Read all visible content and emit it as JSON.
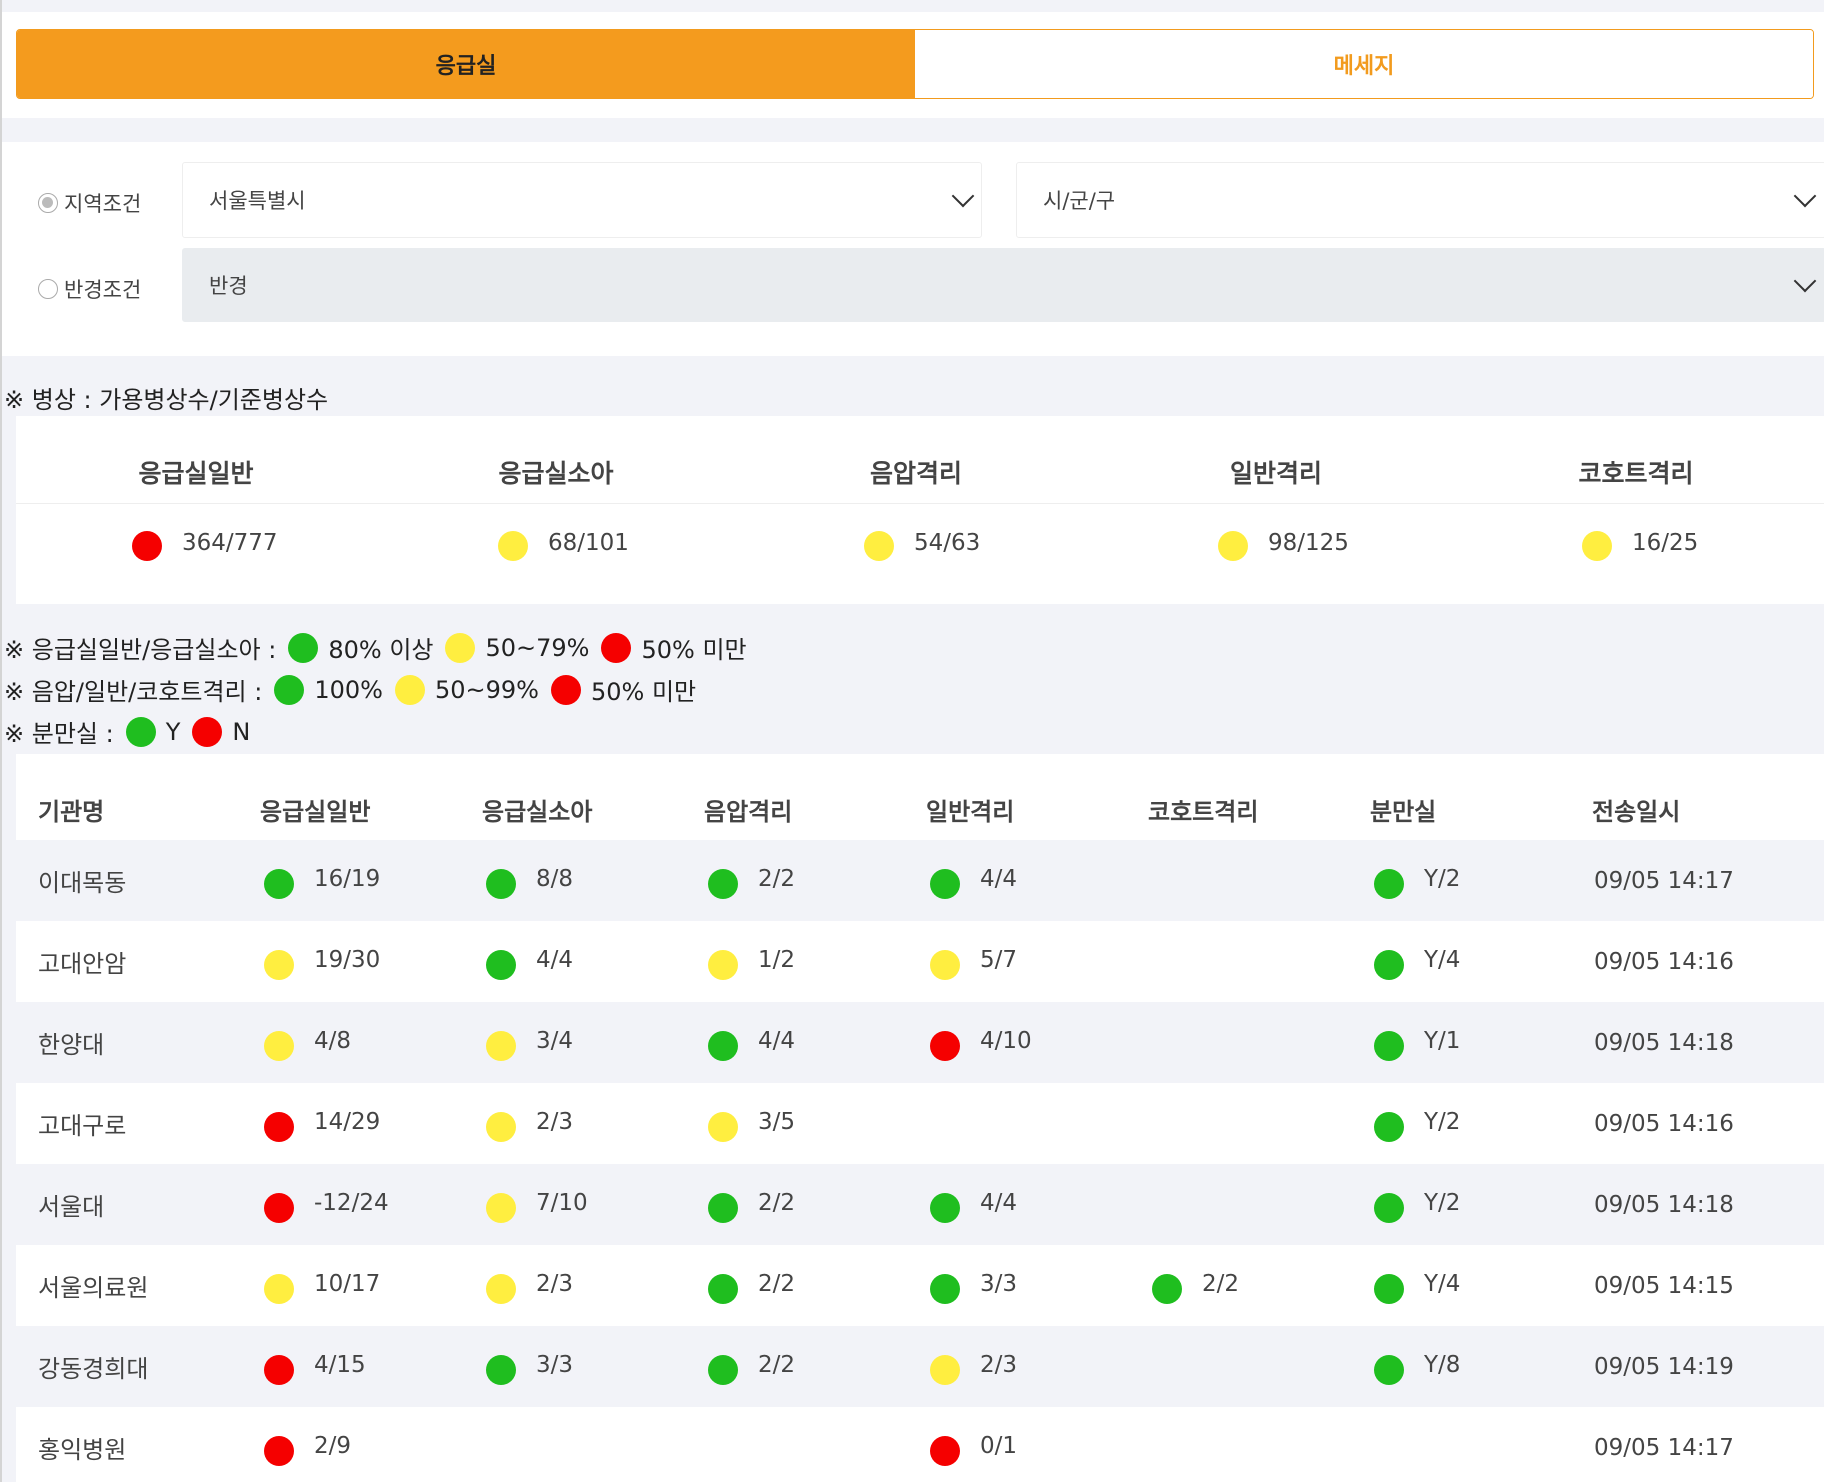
{
  "tabs": [
    {
      "label": "응급실",
      "active": true
    },
    {
      "label": "메세지",
      "active": false
    }
  ],
  "filter": {
    "region_label": "지역조건",
    "radius_label": "반경조건",
    "city_value": "서울특별시",
    "district_value": "시/군/구",
    "radius_value": "반경"
  },
  "bed_note": "※ 병상 : 가용병상수/기준병상수",
  "summary": {
    "headers": [
      "응급실일반",
      "응급실소아",
      "음압격리",
      "일반격리",
      "코호트격리"
    ],
    "cells": [
      {
        "status": "red",
        "value": "364/777"
      },
      {
        "status": "yellow",
        "value": "68/101"
      },
      {
        "status": "yellow",
        "value": "54/63"
      },
      {
        "status": "yellow",
        "value": "98/125"
      },
      {
        "status": "yellow",
        "value": "16/25"
      }
    ]
  },
  "legend": {
    "line1_prefix": "※ 응급실일반/응급실소아 :",
    "line1_items": [
      {
        "color": "green",
        "text": "80% 이상"
      },
      {
        "color": "yellow",
        "text": "50~79%"
      },
      {
        "color": "red",
        "text": "50% 미만"
      }
    ],
    "line2_prefix": "※ 음압/일반/코호트격리 :",
    "line2_items": [
      {
        "color": "green",
        "text": "100%"
      },
      {
        "color": "yellow",
        "text": "50~99%"
      },
      {
        "color": "red",
        "text": "50% 미만"
      }
    ],
    "line3_prefix": "※ 분만실 :",
    "line3_items": [
      {
        "color": "green",
        "text": "Y"
      },
      {
        "color": "red",
        "text": "N"
      }
    ]
  },
  "table": {
    "headers": [
      "기관명",
      "응급실일반",
      "응급실소아",
      "음압격리",
      "일반격리",
      "코호트격리",
      "분만실",
      "전송일시"
    ],
    "rows": [
      {
        "name": "이대목동",
        "cells": [
          [
            "green",
            "16/19"
          ],
          [
            "green",
            "8/8"
          ],
          [
            "green",
            "2/2"
          ],
          [
            "green",
            "4/4"
          ],
          null,
          [
            "green",
            "Y/2"
          ]
        ],
        "time": "09/05 14:17"
      },
      {
        "name": "고대안암",
        "cells": [
          [
            "yellow",
            "19/30"
          ],
          [
            "green",
            "4/4"
          ],
          [
            "yellow",
            "1/2"
          ],
          [
            "yellow",
            "5/7"
          ],
          null,
          [
            "green",
            "Y/4"
          ]
        ],
        "time": "09/05 14:16"
      },
      {
        "name": "한양대",
        "cells": [
          [
            "yellow",
            "4/8"
          ],
          [
            "yellow",
            "3/4"
          ],
          [
            "green",
            "4/4"
          ],
          [
            "red",
            "4/10"
          ],
          null,
          [
            "green",
            "Y/1"
          ]
        ],
        "time": "09/05 14:18"
      },
      {
        "name": "고대구로",
        "cells": [
          [
            "red",
            "14/29"
          ],
          [
            "yellow",
            "2/3"
          ],
          [
            "yellow",
            "3/5"
          ],
          null,
          null,
          [
            "green",
            "Y/2"
          ]
        ],
        "time": "09/05 14:16"
      },
      {
        "name": "서울대",
        "cells": [
          [
            "red",
            "-12/24"
          ],
          [
            "yellow",
            "7/10"
          ],
          [
            "green",
            "2/2"
          ],
          [
            "green",
            "4/4"
          ],
          null,
          [
            "green",
            "Y/2"
          ]
        ],
        "time": "09/05 14:18"
      },
      {
        "name": "서울의료원",
        "cells": [
          [
            "yellow",
            "10/17"
          ],
          [
            "yellow",
            "2/3"
          ],
          [
            "green",
            "2/2"
          ],
          [
            "green",
            "3/3"
          ],
          [
            "green",
            "2/2"
          ],
          [
            "green",
            "Y/4"
          ]
        ],
        "time": "09/05 14:15"
      },
      {
        "name": "강동경희대",
        "cells": [
          [
            "red",
            "4/15"
          ],
          [
            "green",
            "3/3"
          ],
          [
            "green",
            "2/2"
          ],
          [
            "yellow",
            "2/3"
          ],
          null,
          [
            "green",
            "Y/8"
          ]
        ],
        "time": "09/05 14:19"
      },
      {
        "name": "홍익병원",
        "cells": [
          [
            "red",
            "2/9"
          ],
          null,
          null,
          [
            "red",
            "0/1"
          ],
          null,
          null
        ],
        "time": "09/05 14:17"
      }
    ]
  },
  "colors": {
    "accent": "#f49b1e",
    "green": "#1fbe1f",
    "yellow": "#ffee40",
    "red": "#f50000"
  }
}
